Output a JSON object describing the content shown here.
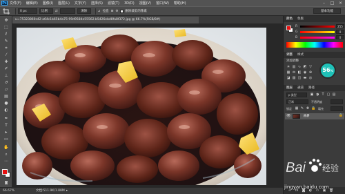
{
  "app": {
    "logo_text": "Ps",
    "menu": [
      "文件(F)",
      "编辑(E)",
      "图像(I)",
      "图层(L)",
      "文字(Y)",
      "选择(S)",
      "滤镜(T)",
      "3D(D)",
      "视图(V)",
      "窗口(W)",
      "帮助(H)"
    ],
    "window_buttons": [
      "–",
      "□",
      "×"
    ]
  },
  "options_bar": {
    "width_field": "0 px",
    "mode_field": "比例",
    "ratio_field": "",
    "swap_icon": "⇄",
    "clear_button": "清除",
    "straighten_label": "拉直",
    "delete_cropped_label": "删除裁剪的像素",
    "workspace_button": "基本功能"
  },
  "document": {
    "tab_title": "u=75323860s42-a64c1b65b4a75-99d9584e55562.b5426ebd8fa8f372.jpg @ 66.7%(RGB/8#)",
    "photo_alt": "braised pork dish"
  },
  "toolbar": {
    "tools": [
      "move",
      "marquee",
      "lasso",
      "quick-select",
      "crop",
      "eyedropper",
      "healing",
      "brush",
      "stamp",
      "history-brush",
      "eraser",
      "gradient",
      "blur",
      "dodge",
      "pen",
      "type",
      "path-select",
      "shape",
      "hand",
      "zoom"
    ]
  },
  "status_bar": {
    "zoom": "66.67%",
    "doc_info": "文档:511.9K/1.88M"
  },
  "color_panel": {
    "tab_color": "颜色",
    "tab_swatches": "色板",
    "r_value": "255",
    "g_value": "0",
    "b_value": "0"
  },
  "adjustments_panel": {
    "tab_adjust": "调整",
    "tab_styles": "样式",
    "add_adjustment_label": "添加调整"
  },
  "layers_panel": {
    "tab_layers": "图层",
    "tab_channels": "通道",
    "tab_paths": "路径",
    "kind_label": "p 类型",
    "blend_mode": "正常",
    "opacity_label": "不透明度",
    "lock_label": "锁定",
    "fill_label": "填充",
    "layer_name": "背景"
  },
  "perf_widget": {
    "value": "56",
    "unit": "%"
  },
  "watermark": {
    "brand_text": "Bai",
    "brand_suffix": "经验",
    "url": "jingyan.baidu.com"
  },
  "colors": {
    "accent": "#31a8ff",
    "foreground": "#e81010",
    "background": "#ffffff",
    "widget": "#1fc1b8"
  }
}
